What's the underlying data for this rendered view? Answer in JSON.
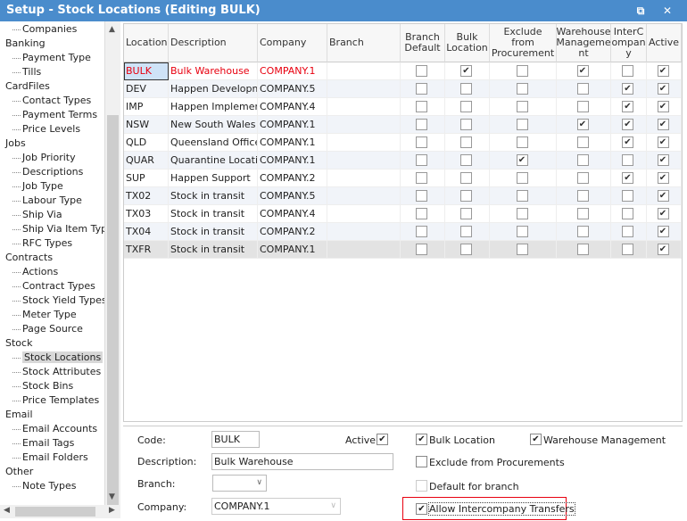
{
  "window": {
    "title": "Setup - Stock Locations (Editing BULK)",
    "restore_icon": "restore-icon",
    "close_icon": "close-icon"
  },
  "tree": [
    {
      "label": "Companies",
      "level": 1
    },
    {
      "label": "Banking",
      "level": 0
    },
    {
      "label": "Payment Type",
      "level": 1
    },
    {
      "label": "Tills",
      "level": 1
    },
    {
      "label": "CardFiles",
      "level": 0
    },
    {
      "label": "Contact Types",
      "level": 1
    },
    {
      "label": "Payment Terms",
      "level": 1
    },
    {
      "label": "Price Levels",
      "level": 1
    },
    {
      "label": "Jobs",
      "level": 0
    },
    {
      "label": "Job Priority",
      "level": 1
    },
    {
      "label": "Descriptions",
      "level": 1
    },
    {
      "label": "Job Type",
      "level": 1
    },
    {
      "label": "Labour Type",
      "level": 1
    },
    {
      "label": "Ship Via",
      "level": 1
    },
    {
      "label": "Ship Via Item Types",
      "level": 1
    },
    {
      "label": "RFC Types",
      "level": 1
    },
    {
      "label": "Contracts",
      "level": 0
    },
    {
      "label": "Actions",
      "level": 1
    },
    {
      "label": "Contract Types",
      "level": 1
    },
    {
      "label": "Stock Yield Types",
      "level": 1
    },
    {
      "label": "Meter Type",
      "level": 1
    },
    {
      "label": "Page Source",
      "level": 1
    },
    {
      "label": "Stock",
      "level": 0
    },
    {
      "label": "Stock Locations",
      "level": 1,
      "selected": true
    },
    {
      "label": "Stock Attributes",
      "level": 1
    },
    {
      "label": "Stock Bins",
      "level": 1
    },
    {
      "label": "Price Templates",
      "level": 1
    },
    {
      "label": "Email",
      "level": 0
    },
    {
      "label": "Email Accounts",
      "level": 1
    },
    {
      "label": "Email Tags",
      "level": 1
    },
    {
      "label": "Email Folders",
      "level": 1
    },
    {
      "label": "Other",
      "level": 0
    },
    {
      "label": "Note Types",
      "level": 1
    }
  ],
  "grid": {
    "columns": [
      "Location",
      "Description",
      "Company",
      "Branch",
      "Branch Default",
      "Bulk Location",
      "Exclude from Procurement",
      "Warehouse Manageme nt",
      "InterC ompan y",
      "Active"
    ],
    "rows": [
      {
        "location": "BULK",
        "description": "Bulk Warehouse",
        "company": "COMPANY.1",
        "branch": "",
        "checks": [
          0,
          1,
          0,
          1,
          0,
          1
        ]
      },
      {
        "location": "DEV",
        "description": "Happen Development",
        "company": "COMPANY.5",
        "branch": "",
        "checks": [
          0,
          0,
          0,
          0,
          1,
          1
        ]
      },
      {
        "location": "IMP",
        "description": "Happen Implementation",
        "company": "COMPANY.4",
        "branch": "",
        "checks": [
          0,
          0,
          0,
          0,
          1,
          1
        ]
      },
      {
        "location": "NSW",
        "description": "New South Wales Office",
        "company": "COMPANY.1",
        "branch": "",
        "checks": [
          0,
          0,
          0,
          1,
          1,
          1
        ]
      },
      {
        "location": "QLD",
        "description": "Queensland Office",
        "company": "COMPANY.1",
        "branch": "",
        "checks": [
          0,
          0,
          0,
          0,
          1,
          1
        ]
      },
      {
        "location": "QUAR",
        "description": "Quarantine Location",
        "company": "COMPANY.1",
        "branch": "",
        "checks": [
          0,
          0,
          1,
          0,
          0,
          1
        ]
      },
      {
        "location": "SUP",
        "description": "Happen Support",
        "company": "COMPANY.2",
        "branch": "",
        "checks": [
          0,
          0,
          0,
          0,
          1,
          1
        ]
      },
      {
        "location": "TX02",
        "description": "Stock in transit",
        "company": "COMPANY.5",
        "branch": "",
        "checks": [
          0,
          0,
          0,
          0,
          0,
          1
        ]
      },
      {
        "location": "TX03",
        "description": "Stock in transit",
        "company": "COMPANY.4",
        "branch": "",
        "checks": [
          0,
          0,
          0,
          0,
          0,
          1
        ]
      },
      {
        "location": "TX04",
        "description": "Stock in transit",
        "company": "COMPANY.2",
        "branch": "",
        "checks": [
          0,
          0,
          0,
          0,
          0,
          1
        ]
      },
      {
        "location": "TXFR",
        "description": "Stock in transit",
        "company": "COMPANY.1",
        "branch": "",
        "checks": [
          0,
          0,
          0,
          0,
          0,
          1
        ]
      }
    ]
  },
  "form": {
    "code_label": "Code:",
    "code": "BULK",
    "description_label": "Description:",
    "description": "Bulk Warehouse",
    "branch_label": "Branch:",
    "branch": "",
    "company_label": "Company:",
    "company": "COMPANY.1",
    "active_label": "Active",
    "active": true,
    "bulk_label": "Bulk Location",
    "bulk": true,
    "warehouse_label": "Warehouse Management",
    "warehouse": true,
    "exclude_label": "Exclude from Procurements",
    "exclude": false,
    "default_label": "Default for branch",
    "default": false,
    "interco_label": "Allow Intercompany Transfers",
    "interco": true
  },
  "colors": {
    "title_bar": "#4a8ccc",
    "edited_row_text": "#e8000f",
    "highlight_box": "#e8000f"
  }
}
